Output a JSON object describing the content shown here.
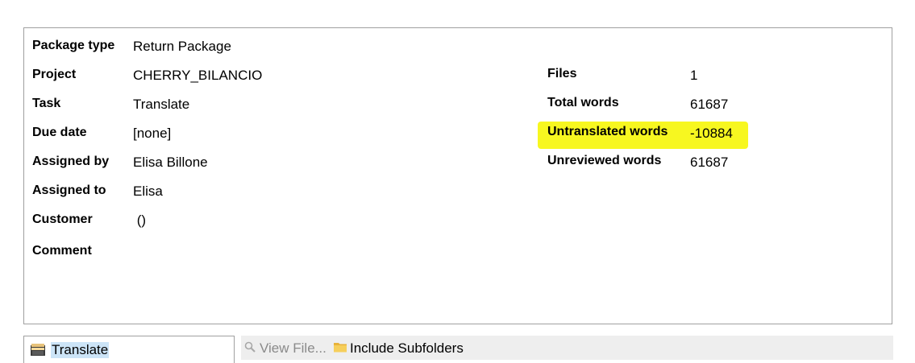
{
  "details_left": [
    {
      "label": "Package type",
      "value": "Return Package"
    },
    {
      "label": "Project",
      "value": "CHERRY_BILANCIO"
    },
    {
      "label": "Task",
      "value": "Translate"
    },
    {
      "label": "Due date",
      "value": "[none]"
    },
    {
      "label": "Assigned by",
      "value": "Elisa Billone"
    },
    {
      "label": "Assigned to",
      "value": "Elisa"
    },
    {
      "label": "Customer",
      "value": " ()"
    },
    {
      "label": "Comment",
      "value": ""
    }
  ],
  "details_right": [
    {
      "label": "Files",
      "value": "1"
    },
    {
      "label": "Total words",
      "value": "61687"
    },
    {
      "label": "Untranslated words",
      "value": "-10884"
    },
    {
      "label": "Unreviewed words",
      "value": "61687"
    }
  ],
  "highlight_color": "#f7f720",
  "bottom": {
    "task_tab_label": "Translate",
    "task_tab_icon": "package-icon",
    "view_file_label": "View File...",
    "view_file_icon": "magnifier-icon",
    "include_subfolders_label": "Include Subfolders",
    "include_subfolders_icon": "folder-icon"
  }
}
